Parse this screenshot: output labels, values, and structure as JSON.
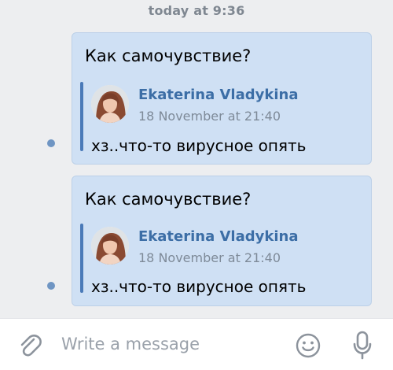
{
  "chat": {
    "date_label": "today at 9:36",
    "messages": [
      {
        "text": "Как самочувствие?",
        "forwarded": {
          "author": "Ekaterina Vladykina",
          "time": "18 November at 21:40",
          "text": "хз..что-то вирусное опять"
        }
      },
      {
        "text": "Как самочувствие?",
        "forwarded": {
          "author": "Ekaterina Vladykina",
          "time": "18 November at 21:40",
          "text": "хз..что-то вирусное опять"
        }
      }
    ]
  },
  "composer": {
    "placeholder": "Write a message",
    "attach_icon": "paperclip-icon",
    "emoji_icon": "smiley-icon",
    "mic_icon": "microphone-icon"
  },
  "colors": {
    "bubble": "#cfe0f4",
    "author": "#3c6ea6",
    "accent_bar": "#4a7ab8",
    "unread_dot": "#6f95c3",
    "background": "#edeef0"
  }
}
